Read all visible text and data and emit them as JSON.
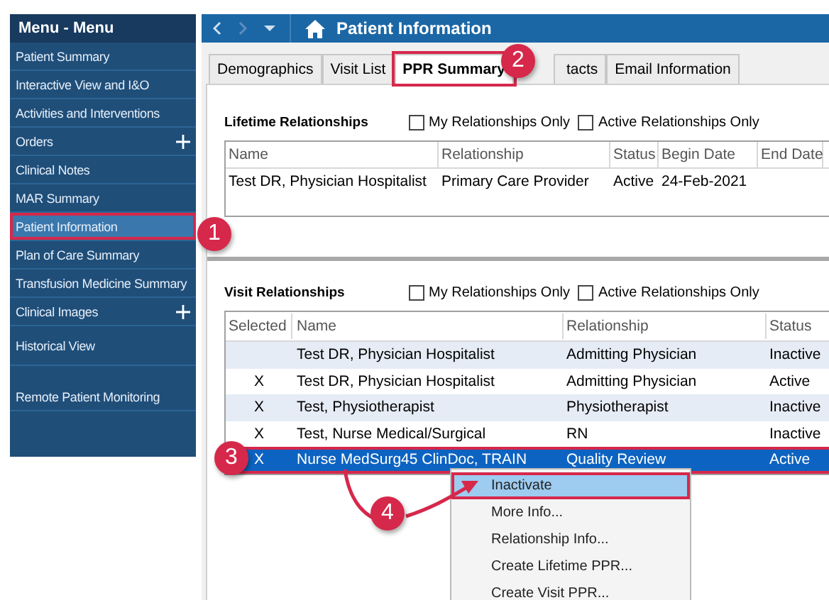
{
  "sidebar": {
    "title": "Menu - Menu",
    "items": [
      {
        "label": "Patient Summary",
        "expandable": false,
        "selected": false,
        "highlighted": false
      },
      {
        "label": "Interactive View and I&O",
        "expandable": false,
        "selected": false,
        "highlighted": false
      },
      {
        "label": "Activities and Interventions",
        "expandable": false,
        "selected": false,
        "highlighted": false
      },
      {
        "label": "Orders",
        "expandable": true,
        "selected": false,
        "highlighted": false
      },
      {
        "label": "Clinical Notes",
        "expandable": false,
        "selected": false,
        "highlighted": false
      },
      {
        "label": "MAR Summary",
        "expandable": false,
        "selected": false,
        "highlighted": false
      },
      {
        "label": "Patient Information",
        "expandable": false,
        "selected": true,
        "highlighted": true
      },
      {
        "label": "Plan of Care Summary",
        "expandable": false,
        "selected": false,
        "highlighted": false
      },
      {
        "label": "Transfusion Medicine Summary",
        "expandable": false,
        "selected": false,
        "highlighted": false
      },
      {
        "label": "Clinical Images",
        "expandable": true,
        "selected": false,
        "highlighted": false
      },
      {
        "label": "Historical View",
        "expandable": false,
        "selected": false,
        "highlighted": false
      },
      {
        "label": "Remote Patient Monitoring",
        "expandable": false,
        "selected": false,
        "highlighted": false
      }
    ]
  },
  "header": {
    "title": "Patient Information"
  },
  "tabs": [
    {
      "label": "Demographics",
      "selected": false,
      "highlighted": false
    },
    {
      "label": "Visit List",
      "selected": false,
      "highlighted": false
    },
    {
      "label": "PPR Summary",
      "selected": true,
      "highlighted": true
    },
    {
      "label": "tacts",
      "selected": false,
      "highlighted": false
    },
    {
      "label": "Email Information",
      "selected": false,
      "highlighted": false
    }
  ],
  "lifetime": {
    "title": "Lifetime Relationships",
    "filters": [
      {
        "label": "My Relationships Only",
        "checked": false
      },
      {
        "label": "Active Relationships Only",
        "checked": false
      }
    ],
    "columns": [
      "Name",
      "Relationship",
      "Status",
      "Begin Date",
      "End Date"
    ],
    "rows": [
      {
        "name": "Test DR, Physician Hospitalist",
        "relationship": "Primary Care Provider",
        "status": "Active",
        "begin_date": "24-Feb-2021"
      }
    ]
  },
  "visit": {
    "title": "Visit Relationships",
    "filters": [
      {
        "label": "My Relationships Only",
        "checked": false
      },
      {
        "label": "Active Relationships Only",
        "checked": false
      }
    ],
    "columns": [
      "Selected",
      "Name",
      "Relationship",
      "Status"
    ],
    "rows": [
      {
        "name": "Test DR, Physician Hospitalist",
        "relationship": "Admitting Physician",
        "status": "Inactive",
        "selected": false,
        "highlighted": false
      },
      {
        "mark": "X",
        "name": "Test DR, Physician Hospitalist",
        "relationship": "Admitting Physician",
        "status": "Active",
        "selected": false,
        "highlighted": false
      },
      {
        "mark": "X",
        "name": "Test, Physiotherapist",
        "relationship": "Physiotherapist",
        "status": "Inactive",
        "selected": false,
        "highlighted": false
      },
      {
        "mark": "X",
        "name": "Test, Nurse Medical/Surgical",
        "relationship": "RN",
        "status": "Inactive",
        "selected": false,
        "highlighted": false
      },
      {
        "mark": "X",
        "name": "Nurse MedSurg45 ClinDoc, TRAIN",
        "relationship": "Quality Review",
        "status": "Active",
        "selected": true,
        "highlighted": true
      }
    ]
  },
  "context_menu": {
    "items": [
      {
        "label": "Inactivate",
        "selected": true,
        "highlighted": true
      },
      {
        "label": "More Info...",
        "selected": false,
        "highlighted": false
      },
      {
        "label": "Relationship Info...",
        "selected": false,
        "highlighted": false
      },
      {
        "label": "Create Lifetime PPR...",
        "selected": false,
        "highlighted": false
      },
      {
        "label": "Create Visit PPR...",
        "selected": false,
        "highlighted": false
      }
    ]
  },
  "callouts": [
    "1",
    "2",
    "3",
    "4"
  ]
}
